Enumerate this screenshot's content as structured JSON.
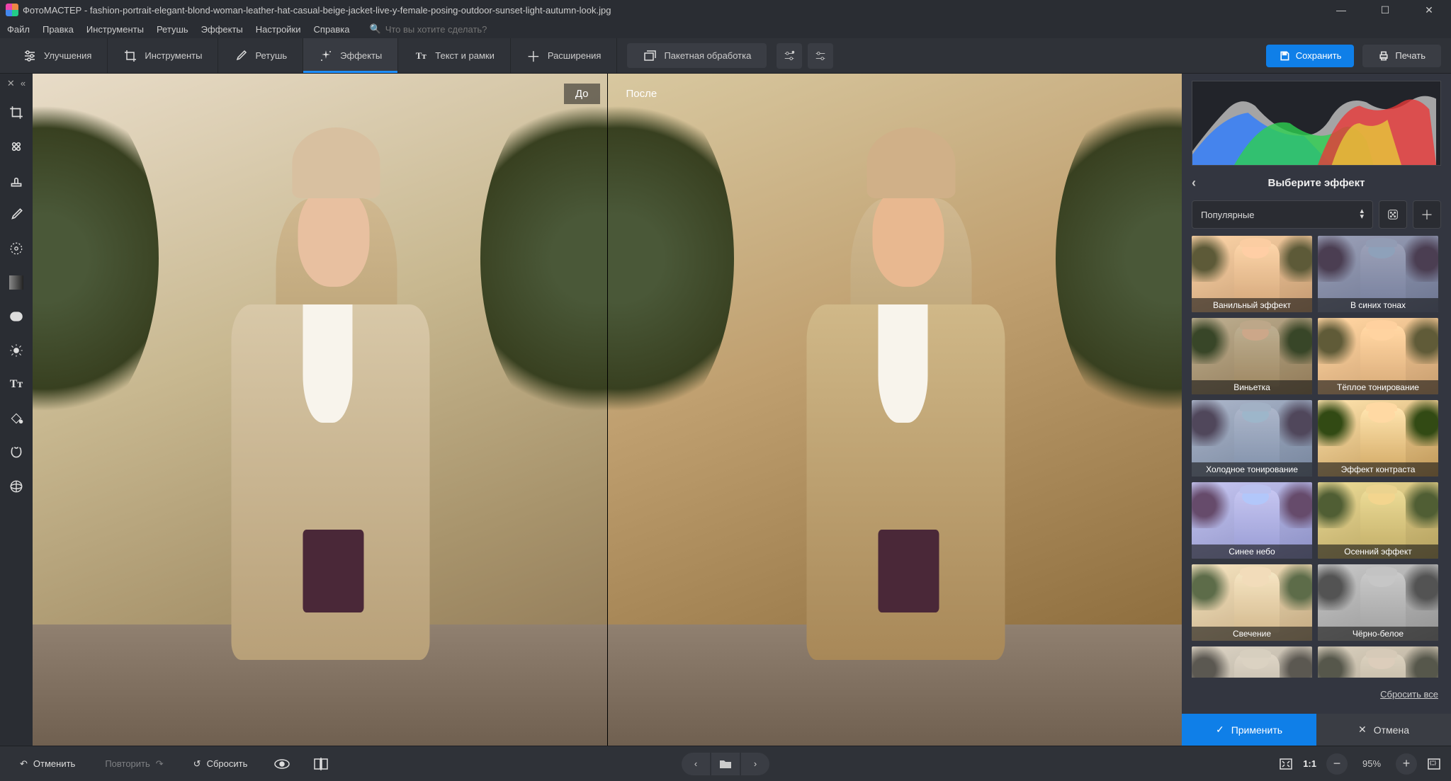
{
  "titlebar": {
    "app_name": "ФотоМАСТЕР",
    "filename": "fashion-portrait-elegant-blond-woman-leather-hat-casual-beige-jacket-live-y-female-posing-outdoor-sunset-light-autumn-look.jpg"
  },
  "menubar": {
    "items": [
      "Файл",
      "Правка",
      "Инструменты",
      "Ретушь",
      "Эффекты",
      "Настройки",
      "Справка"
    ],
    "search_placeholder": "Что вы хотите сделать?"
  },
  "toolbar": {
    "tabs": [
      {
        "label": "Улучшения",
        "icon": "sliders"
      },
      {
        "label": "Инструменты",
        "icon": "crop"
      },
      {
        "label": "Ретушь",
        "icon": "brush"
      },
      {
        "label": "Эффекты",
        "icon": "sparkle",
        "active": true
      },
      {
        "label": "Текст и рамки",
        "icon": "text"
      },
      {
        "label": "Расширения",
        "icon": "plus"
      }
    ],
    "batch_label": "Пакетная обработка",
    "save_label": "Сохранить",
    "print_label": "Печать"
  },
  "canvas": {
    "before_label": "До",
    "after_label": "После"
  },
  "right_panel": {
    "header": "Выберите эффект",
    "category": "Популярные",
    "effects": [
      "Ванильный эффект",
      "В синих тонах",
      "Виньетка",
      "Тёплое тонирование",
      "Холодное тонирование",
      "Эффект контраста",
      "Синее небо",
      "Осенний эффект",
      "Свечение",
      "Чёрно-белое",
      "",
      ""
    ],
    "reset_label": "Сбросить все",
    "apply_label": "Применить",
    "cancel_label": "Отмена"
  },
  "bottom_bar": {
    "undo_label": "Отменить",
    "redo_label": "Повторить",
    "reset_label": "Сбросить",
    "zoom_value": "95%",
    "fit_label": "1:1"
  },
  "effect_tints": [
    "sepia(.4) saturate(1.3) hue-rotate(-10deg)",
    "saturate(.8) hue-rotate(190deg) brightness(.8)",
    "brightness(.85) contrast(1.1)",
    "sepia(.5) saturate(1.4) hue-rotate(-8deg)",
    "saturate(.7) hue-rotate(180deg) brightness(.9)",
    "contrast(1.4) saturate(1.2)",
    "saturate(1.1) hue-rotate(200deg)",
    "sepia(.4) saturate(1.5) hue-rotate(10deg)",
    "brightness(1.2) contrast(.9)",
    "grayscale(1)",
    "grayscale(1) sepia(.3)",
    "grayscale(.7) sepia(.2)"
  ]
}
